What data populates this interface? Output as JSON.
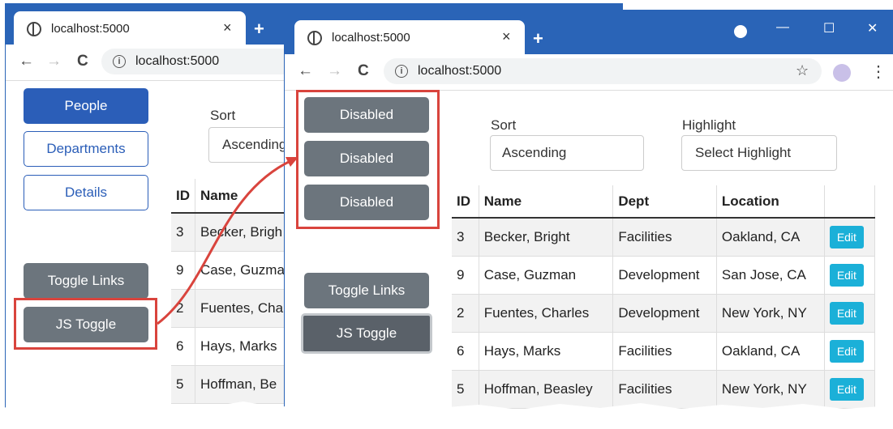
{
  "left_window": {
    "tab_title": "localhost:5000",
    "tab_close": "×",
    "new_tab": "+",
    "url": "localhost:5000",
    "nav": {
      "back": "←",
      "forward": "→",
      "reload": "C"
    },
    "buttons": {
      "people": "People",
      "departments": "Departments",
      "details": "Details",
      "toggle_links": "Toggle Links",
      "js_toggle": "JS Toggle"
    },
    "sort_label": "Sort",
    "sort_value": "Ascending",
    "table": {
      "headers": [
        "ID",
        "Name"
      ],
      "rows": [
        [
          "3",
          "Becker, Brigh"
        ],
        [
          "9",
          "Case, Guzma"
        ],
        [
          "2",
          "Fuentes, Cha"
        ],
        [
          "6",
          "Hays, Marks"
        ],
        [
          "5",
          "Hoffman, Be"
        ]
      ]
    }
  },
  "right_window": {
    "tab_title": "localhost:5000",
    "tab_close": "×",
    "new_tab": "+",
    "window_controls": {
      "minimize": "—",
      "maximize": "☐",
      "close": "✕"
    },
    "url": "localhost:5000",
    "nav": {
      "back": "←",
      "forward": "→",
      "reload": "C"
    },
    "disabled_buttons": [
      "Disabled",
      "Disabled",
      "Disabled"
    ],
    "buttons": {
      "toggle_links": "Toggle Links",
      "js_toggle": "JS Toggle"
    },
    "sort_label": "Sort",
    "sort_value": "Ascending",
    "highlight_label": "Highlight",
    "highlight_value": "Select Highlight",
    "table": {
      "headers": [
        "ID",
        "Name",
        "Dept",
        "Location",
        ""
      ],
      "rows": [
        [
          "3",
          "Becker, Bright",
          "Facilities",
          "Oakland, CA"
        ],
        [
          "9",
          "Case, Guzman",
          "Development",
          "San Jose, CA"
        ],
        [
          "2",
          "Fuentes, Charles",
          "Development",
          "New York, NY"
        ],
        [
          "6",
          "Hays, Marks",
          "Facilities",
          "Oakland, CA"
        ],
        [
          "5",
          "Hoffman, Beasley",
          "Facilities",
          "New York, NY"
        ]
      ],
      "edit_label": "Edit"
    }
  },
  "colors": {
    "accent": "#2b5eb8",
    "chrome": "#2a64b7",
    "highlight_box": "#d9443d",
    "edit": "#1bb0d8"
  }
}
